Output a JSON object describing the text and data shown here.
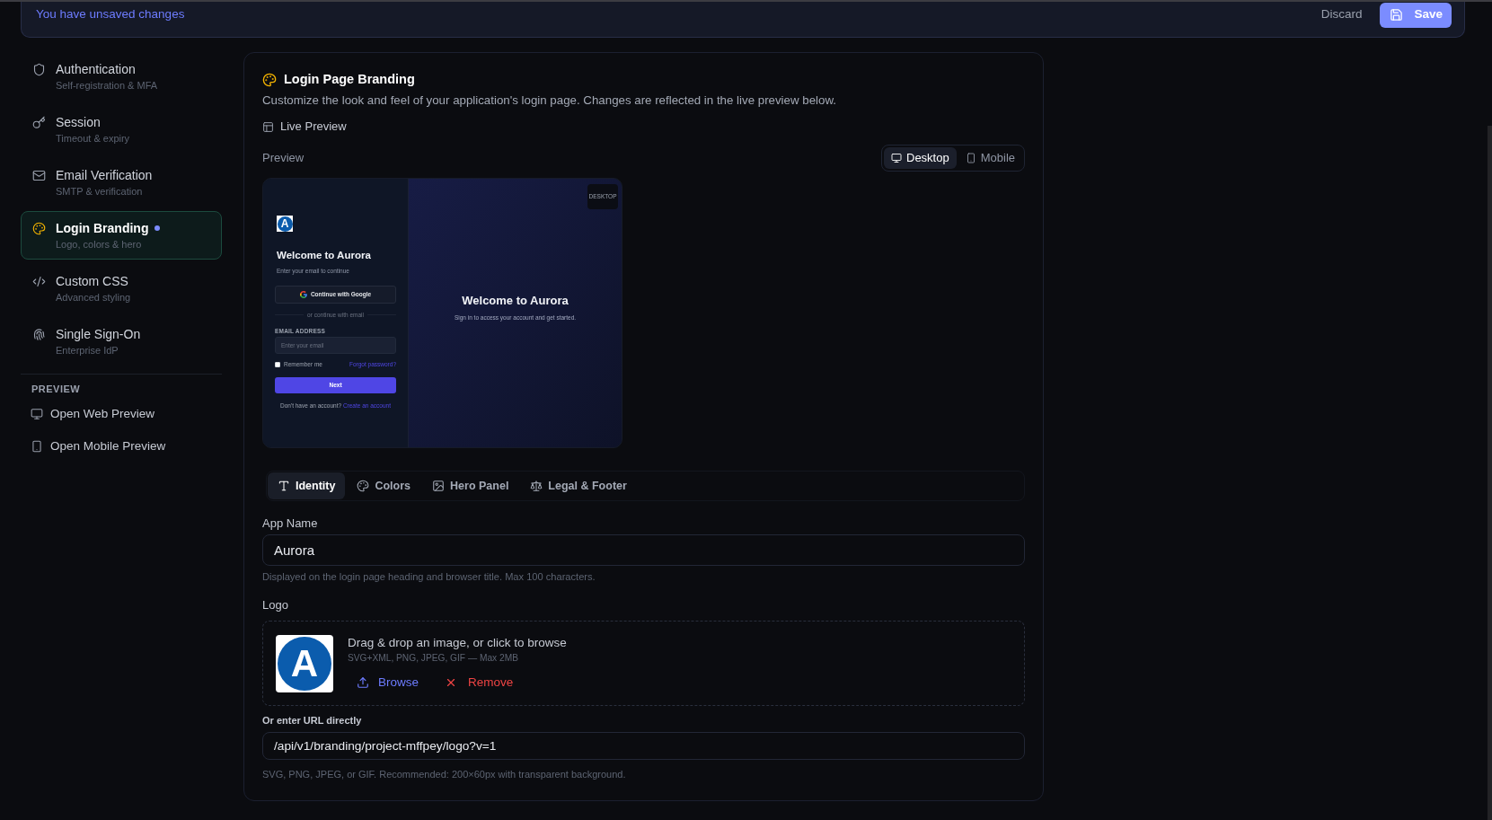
{
  "unsaved_bar": {
    "message": "You have unsaved changes",
    "discard_label": "Discard",
    "save_label": "Save"
  },
  "sidebar": {
    "items": [
      {
        "title": "Authentication",
        "subtitle": "Self-registration & MFA",
        "selected": false,
        "unsaved": false
      },
      {
        "title": "Session",
        "subtitle": "Timeout & expiry",
        "selected": false,
        "unsaved": false
      },
      {
        "title": "Email Verification",
        "subtitle": "SMTP & verification",
        "selected": false,
        "unsaved": false
      },
      {
        "title": "Login Branding",
        "subtitle": "Logo, colors & hero",
        "selected": true,
        "unsaved": true
      },
      {
        "title": "Custom CSS",
        "subtitle": "Advanced styling",
        "selected": false,
        "unsaved": false
      },
      {
        "title": "Single Sign-On",
        "subtitle": "Enterprise IdP",
        "selected": false,
        "unsaved": false
      }
    ],
    "preview_heading": "PREVIEW",
    "preview_links": [
      "Open Web Preview",
      "Open Mobile Preview"
    ]
  },
  "branding": {
    "title": "Login Page Branding",
    "description": "Customize the look and feel of your application's login page. Changes are reflected in the live preview below.",
    "live_preview_label": "Live Preview",
    "preview_label": "Preview",
    "device_toggle": [
      {
        "label": "Desktop",
        "selected": true
      },
      {
        "label": "Mobile",
        "selected": false
      }
    ],
    "login_preview": {
      "badge": "DESKTOP",
      "logo_letter": "A",
      "heading": "Welcome to Aurora",
      "subheading": "Enter your email to continue",
      "google_button": "Continue with Google",
      "divider_text": "or continue with email",
      "email_label": "EMAIL ADDRESS",
      "email_placeholder": "Enter your email",
      "remember_label": "Remember me",
      "remember_checked": false,
      "forgot_link": "Forgot password?",
      "next_button": "Next",
      "signup_prompt": "Don't have an account?",
      "signup_link": "Create an account",
      "hero_heading": "Welcome to Aurora",
      "hero_subheading": "Sign in to access your account and get started."
    },
    "tabs": [
      {
        "label": "Identity",
        "selected": true
      },
      {
        "label": "Colors",
        "selected": false
      },
      {
        "label": "Hero Panel",
        "selected": false
      },
      {
        "label": "Legal & Footer",
        "selected": false
      }
    ],
    "app_name": {
      "label": "App Name",
      "value": "Aurora",
      "hint": "Displayed on the login page heading and browser title. Max 100 characters."
    },
    "logo": {
      "label": "Logo",
      "logo_letter": "A",
      "dropzone_text": "Drag & drop an image, or click to browse",
      "formats": "SVG+XML, PNG, JPEG, GIF — Max 2MB",
      "browse_button": "Browse",
      "remove_button": "Remove"
    },
    "logo_url": {
      "label": "Or enter URL directly",
      "value": "/api/v1/branding/project-mffpey/logo?v=1",
      "hint": "SVG, PNG, JPEG, or GIF. Recommended: 200×60px with transparent background."
    }
  }
}
